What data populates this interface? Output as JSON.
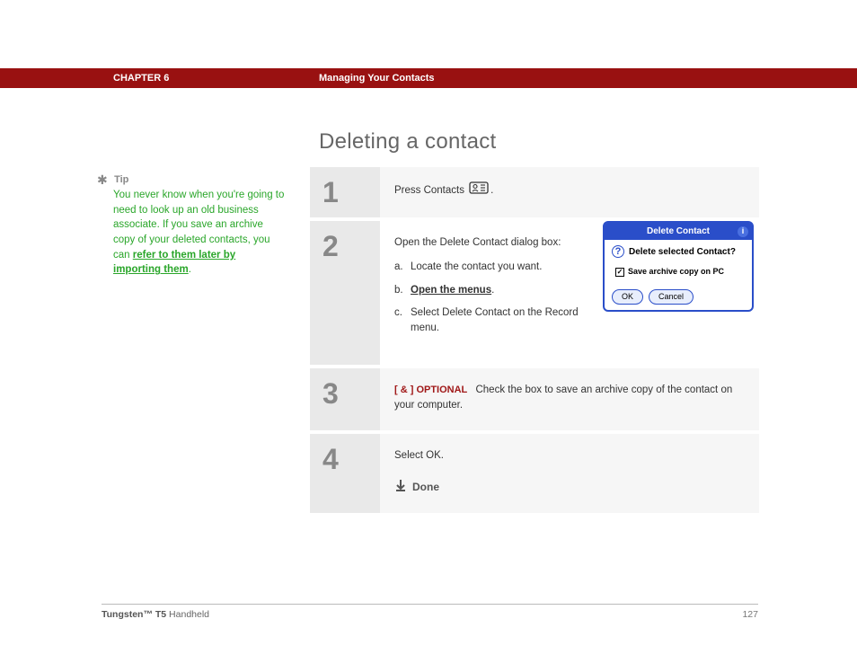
{
  "header": {
    "chapter_label": "CHAPTER 6",
    "chapter_title": "Managing Your Contacts"
  },
  "page_title": "Deleting a contact",
  "sidebar_tip": {
    "label": "Tip",
    "body_prefix": "You never know when you're going to need to look up an old business associate. If you save an archive copy of your deleted contacts, you can ",
    "link_text": "refer to them later by importing them",
    "body_suffix": "."
  },
  "steps": [
    {
      "num": "1",
      "text_before": "Press Contacts ",
      "text_after": "."
    },
    {
      "num": "2",
      "intro": "Open the Delete Contact dialog box:",
      "sub": [
        {
          "letter": "a.",
          "text": "Locate the contact you want."
        },
        {
          "letter": "b.",
          "text": "Open the menus",
          "is_link": true,
          "suffix": "."
        },
        {
          "letter": "c.",
          "text": "Select Delete Contact on the Record menu."
        }
      ]
    },
    {
      "num": "3",
      "optional_tag": "[ & ]  OPTIONAL",
      "text": "Check the box to save an archive copy of the contact on your computer."
    },
    {
      "num": "4",
      "text": "Select OK.",
      "done_label": "Done"
    }
  ],
  "dialog": {
    "title": "Delete Contact",
    "message": "Delete selected Contact?",
    "checkbox_label": "Save archive copy on PC",
    "ok": "OK",
    "cancel": "Cancel"
  },
  "footer": {
    "product_bold": "Tungsten™ T5",
    "product_rest": " Handheld",
    "page_number": "127"
  }
}
